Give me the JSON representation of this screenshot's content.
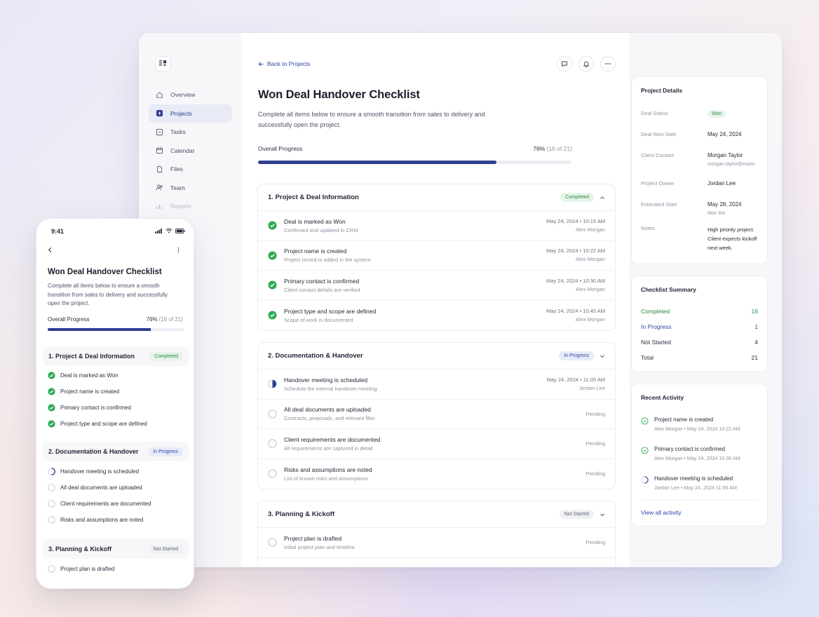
{
  "nav": {
    "items": [
      {
        "label": "Overview",
        "icon": "home-icon"
      },
      {
        "label": "Projects",
        "icon": "projects-icon"
      },
      {
        "label": "Tasks",
        "icon": "tasks-icon"
      },
      {
        "label": "Calendar",
        "icon": "calendar-icon"
      },
      {
        "label": "Files",
        "icon": "file-icon"
      },
      {
        "label": "Team",
        "icon": "team-icon"
      },
      {
        "label": "Reports",
        "icon": "reports-icon"
      }
    ]
  },
  "main": {
    "back_label": "Back to Projects",
    "title": "Won Deal Handover Checklist",
    "description": "Complete all items below to ensure a smooth transition from sales to delivery and successfully open the project.",
    "progress_label": "Overall Progress",
    "progress_percent": "76%",
    "progress_count": "(16 of 21)",
    "progress_fraction": 0.76
  },
  "sections": [
    {
      "title": "1. Project & Deal Information",
      "badge": "Completed",
      "tasks": [
        {
          "title": "Deal is marked as Won",
          "sub": "Confirmed and updated in CRM",
          "date": "May 24, 2024",
          "time": "10:15 AM",
          "who": "Alex Morgan"
        },
        {
          "title": "Project name is created",
          "sub": "Project record is added in the system",
          "date": "May 24, 2024",
          "time": "10:22 AM",
          "who": "Alex Morgan"
        },
        {
          "title": "Primary contact is confirmed",
          "sub": "Client contact details are verified",
          "date": "May 24, 2024",
          "time": "10:30 AM",
          "who": "Alex Morgan"
        },
        {
          "title": "Project type and scope are defined",
          "sub": "Scope of work is documented",
          "date": "May 24, 2024",
          "time": "10:45 AM",
          "who": "Alex Morgan"
        }
      ]
    },
    {
      "title": "2. Documentation & Handover",
      "badge": "In Progress",
      "tasks": [
        {
          "title": "Handover meeting is scheduled",
          "sub": "Schedule the internal handover meeting",
          "date": "May 24, 2024",
          "time": "11:00 AM",
          "who": "Jordan Lee"
        },
        {
          "title": "All deal documents are uploaded",
          "sub": "Contracts, proposals, and relevant files",
          "status": "Pending"
        },
        {
          "title": "Client requirements are documented",
          "sub": "All requirements are captured in detail",
          "status": "Pending"
        },
        {
          "title": "Risks and assumptions are noted",
          "sub": "List of known risks and assumptions",
          "status": "Pending"
        }
      ]
    },
    {
      "title": "3. Planning & Kickoff",
      "badge": "Not Started",
      "tasks": [
        {
          "title": "Project plan is drafted",
          "sub": "Initial project plan and timeline",
          "status": "Pending"
        }
      ]
    }
  ],
  "details": {
    "title": "Project Details",
    "deal_status_label": "Deal Status",
    "deal_status": "Won",
    "won_date_label": "Deal Won Date",
    "won_date": "May 24, 2024",
    "client_contact_label": "Client Contact",
    "client_contact_name": "Morgan Taylor",
    "client_contact_email": "morgan.taylor@exam",
    "owner_label": "Project Owner",
    "owner": "Jordan Lee",
    "start_label": "Estimated Start",
    "start": "May 28, 2024",
    "start_sub": "Mon 8m",
    "notes_label": "Notes",
    "notes": "High priority project. Client expects kickoff next week."
  },
  "summary": {
    "title": "Checklist Summary",
    "rows": [
      {
        "label": "Completed",
        "value": "16"
      },
      {
        "label": "In Progress",
        "value": "1"
      },
      {
        "label": "Not Started",
        "value": "4"
      },
      {
        "label": "Total",
        "value": "21"
      }
    ]
  },
  "activity": {
    "title": "Recent Activity",
    "items": [
      {
        "title": "Project name is created",
        "who": "Alex Morgan",
        "when": "May 24, 2024 10:22 AM"
      },
      {
        "title": "Primary contact is confirmed",
        "who": "Alex Morgan",
        "when": "May 24, 2024 10:30 AM"
      },
      {
        "title": "Handover meeting is scheduled",
        "who": "Jordan Lee",
        "when": "May 24, 2024 11:00 AM"
      }
    ],
    "view_all": "View all activity"
  },
  "phone": {
    "time": "9:41",
    "title": "Won Deal Handover Checklist",
    "description": "Complete all items below to ensure a smooth transition from sales to delivery and successfully open the project.",
    "progress_label": "Overall Progress",
    "progress_percent": "76%",
    "progress_count": "(16 of 21)",
    "sections": [
      {
        "title": "1. Project & Deal Information",
        "badge": "Completed",
        "items": [
          "Deal is marked as Won",
          "Project name is created",
          "Primary contact is confirmed",
          "Project type and scope are defined"
        ]
      },
      {
        "title": "2. Documentation & Handover",
        "badge": "In Progress",
        "items": [
          "Handover meeting is scheduled",
          "All deal documents are uploaded",
          "Client requirements are documented",
          "Risks and assumptions are noted"
        ]
      },
      {
        "title": "3. Planning & Kickoff",
        "badge": "Not Started",
        "items": [
          "Project plan is drafted"
        ]
      }
    ]
  },
  "colors": {
    "accent": "#2f3f93",
    "link": "#2f46a6",
    "done": "#2c8a46",
    "done_bg": "#e6f4ea"
  }
}
